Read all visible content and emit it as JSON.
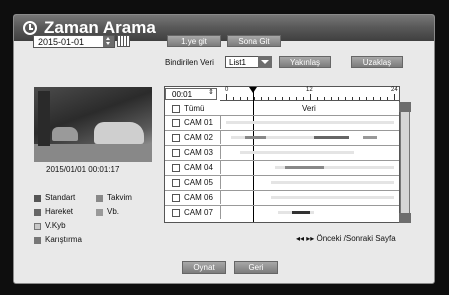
{
  "title": "Zaman Arama",
  "date": "2015-01-01",
  "buttons": {
    "first": "1.ye git",
    "last": "Sona Git",
    "zoom_in": "Yakınlaş",
    "zoom_out": "Uzaklaş",
    "play": "Oynat",
    "back": "Geri"
  },
  "linked_label": "Bindirilen Veri",
  "list_value": "List1",
  "time_value": "00:01",
  "timeline": {
    "ticks": [
      "0",
      "12",
      "24"
    ],
    "header": "Veri",
    "cursor_hour": 1.5
  },
  "select_all": "Tümü",
  "cameras": [
    "CAM 01",
    "CAM 02",
    "CAM 03",
    "CAM 04",
    "CAM 05",
    "CAM 06",
    "CAM 07"
  ],
  "timestamp": "2015/01/01  00:01:17",
  "legend": {
    "standard": "Standart",
    "calendar": "Takvim",
    "motion": "Hareket",
    "other": "Vb.",
    "vloss": "V.Kyb",
    "mixed": "Karıştırma"
  },
  "legend_colors": {
    "standard": "#555555",
    "calendar": "#888888",
    "motion": "#666666",
    "other": "#999999",
    "vloss": "#c8c8c8",
    "mixed": "#777777"
  },
  "page_nav": "◂◂ ▸▸ Önceki /Sonraki Sayfa"
}
